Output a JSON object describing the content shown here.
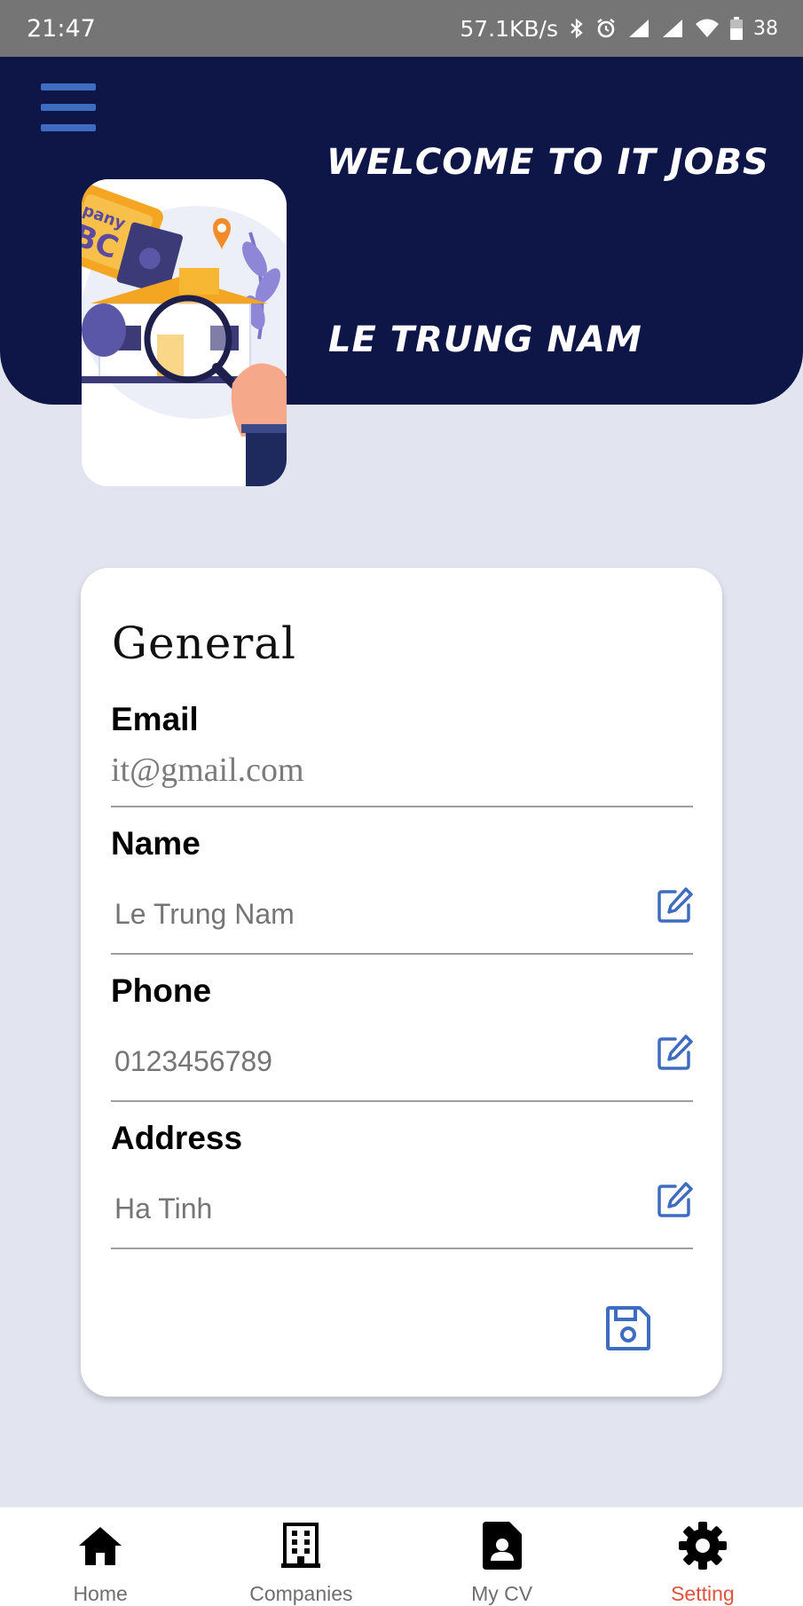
{
  "status_bar": {
    "time": "21:47",
    "network_speed": "57.1KB/s",
    "battery": "38",
    "icons": [
      "bluetooth-icon",
      "alarm-icon",
      "signal-icon",
      "signal-icon",
      "wifi-icon",
      "battery-icon"
    ]
  },
  "header": {
    "welcome": "WELCOME TO IT JOBS",
    "user_name": "LE TRUNG NAM",
    "background_color": "#0e1547",
    "menu_icon": "hamburger-menu-icon"
  },
  "general": {
    "title": "General",
    "fields": [
      {
        "label": "Email",
        "value": "it@gmail.com",
        "editable": false
      },
      {
        "label": "Name",
        "value": "Le Trung Nam",
        "editable": true
      },
      {
        "label": "Phone",
        "value": "0123456789",
        "editable": true
      },
      {
        "label": "Address",
        "value": "Ha Tinh",
        "editable": true
      }
    ],
    "accent_color": "#3e6cc0",
    "save_icon": "save-icon"
  },
  "bottom_nav": {
    "items": [
      {
        "label": "Home",
        "icon": "home-icon",
        "active": false
      },
      {
        "label": "Companies",
        "icon": "building-icon",
        "active": false
      },
      {
        "label": "My CV",
        "icon": "cv-document-icon",
        "active": false
      },
      {
        "label": "Setting",
        "icon": "gear-icon",
        "active": true
      }
    ],
    "active_color": "#e0533f"
  }
}
